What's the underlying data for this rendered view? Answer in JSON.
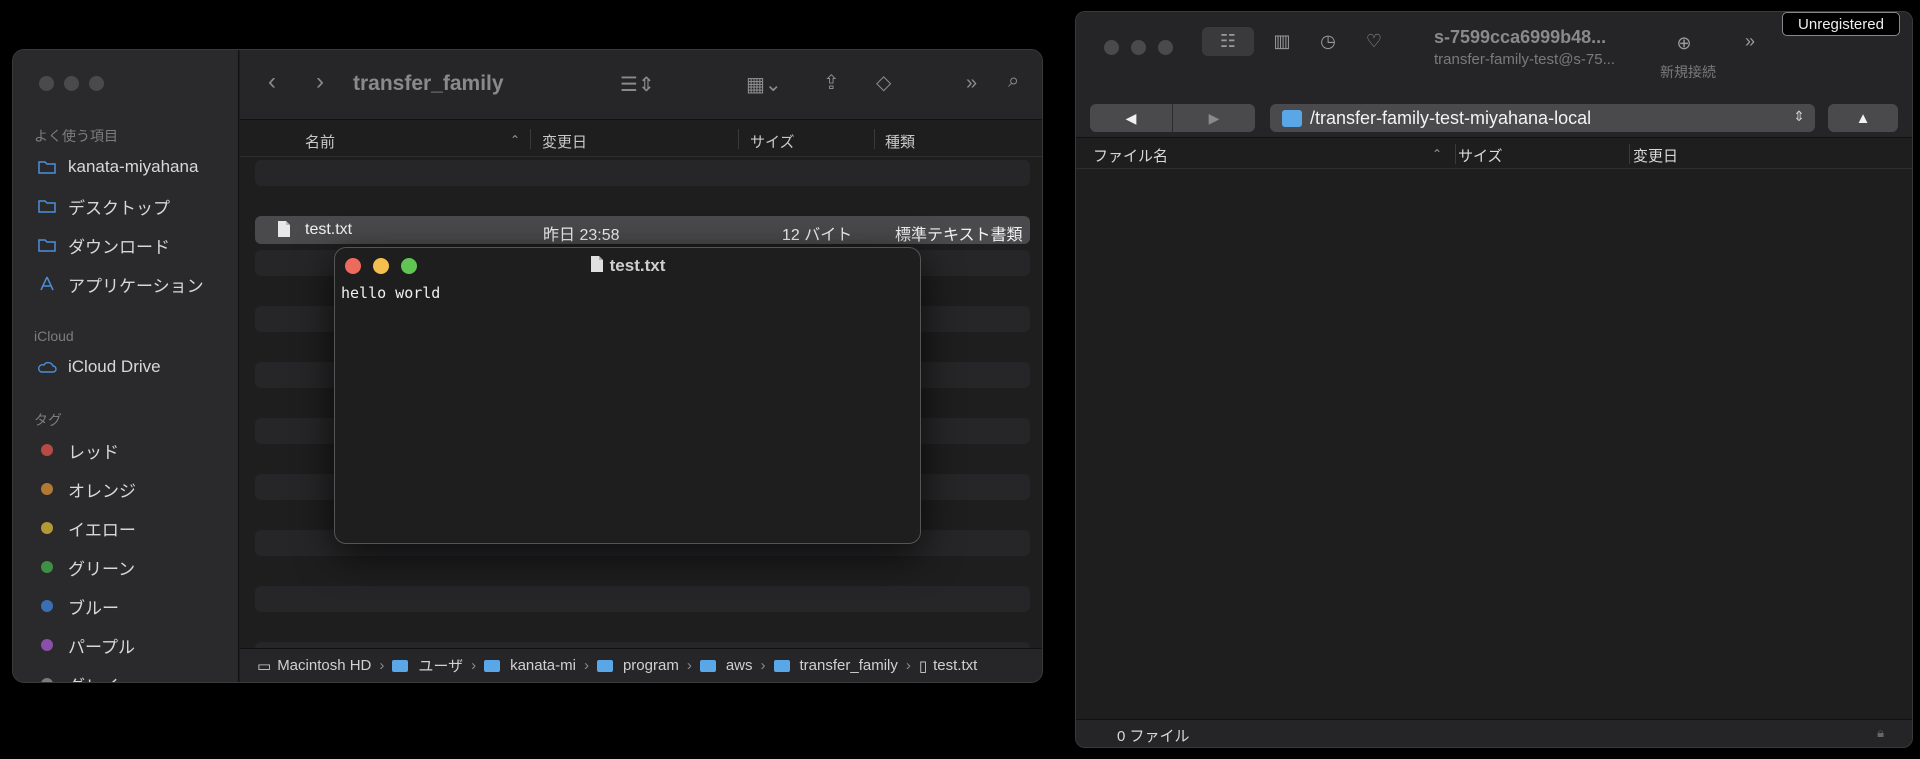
{
  "finder": {
    "title": "transfer_family",
    "sidebar": {
      "favorites_label": "よく使う項目",
      "favorites": [
        "kanata-miyahana",
        "デスクトップ",
        "ダウンロード",
        "アプリケーション"
      ],
      "icloud_label": "iCloud",
      "icloud_items": [
        "iCloud Drive"
      ],
      "tags_label": "タグ",
      "tags": [
        {
          "label": "レッド",
          "color": "#b84a45"
        },
        {
          "label": "オレンジ",
          "color": "#b07a35"
        },
        {
          "label": "イエロー",
          "color": "#b39a36"
        },
        {
          "label": "グリーン",
          "color": "#3f8f45"
        },
        {
          "label": "ブルー",
          "color": "#3a6fb3"
        },
        {
          "label": "パープル",
          "color": "#8a4fa8"
        },
        {
          "label": "グレイ",
          "color": "#7a7a7c"
        }
      ]
    },
    "columns": {
      "name": "名前",
      "modified": "変更日",
      "size": "サイズ",
      "kind": "種類"
    },
    "files": [
      {
        "name": "test.txt",
        "modified": "昨日 23:58",
        "size": "12 バイト",
        "kind": "標準テキスト書類"
      }
    ],
    "path": [
      "Macintosh HD",
      "ユーザ",
      "kanata-mi",
      "program",
      "aws",
      "transfer_family",
      "test.txt"
    ]
  },
  "textedit": {
    "title": "test.txt",
    "content": "hello world"
  },
  "cyberduck": {
    "server": "s-7599cca6999b48...",
    "user": "transfer-family-test@s-75...",
    "new_connection": "新規接続",
    "unregistered": "Unregistered",
    "path": "/transfer-family-test-miyahana-local",
    "columns": {
      "filename": "ファイル名",
      "size": "サイズ",
      "modified": "変更日"
    },
    "status": "0 ファイル"
  }
}
